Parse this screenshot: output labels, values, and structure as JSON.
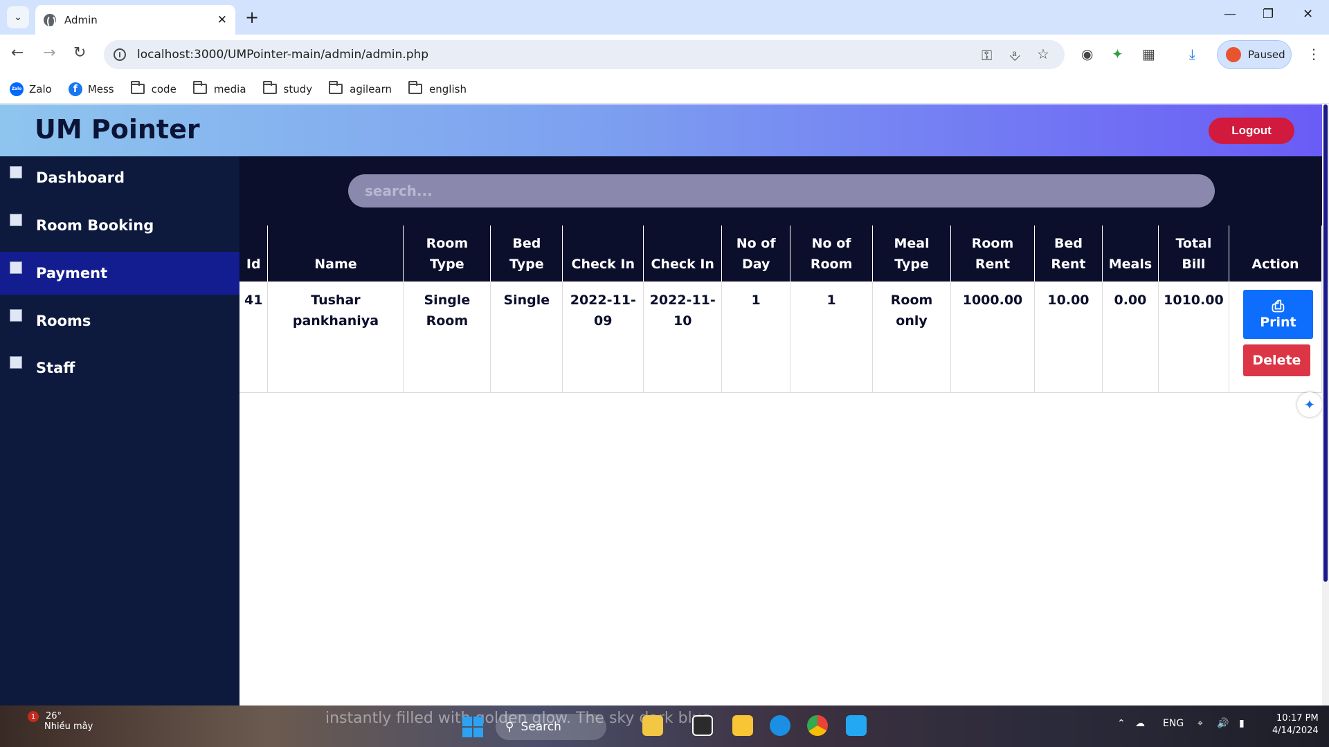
{
  "browser": {
    "tab_title": "Admin",
    "url": "localhost:3000/UMPointer-main/admin/admin.php",
    "profile_label": "Paused",
    "bookmarks": [
      "Zalo",
      "Mess",
      "code",
      "media",
      "study",
      "agilearn",
      "english"
    ]
  },
  "header": {
    "brand": "UM Pointer",
    "logout_label": "Logout"
  },
  "sidebar": {
    "items": [
      {
        "label": "Dashboard"
      },
      {
        "label": "Room Booking"
      },
      {
        "label": "Payment"
      },
      {
        "label": "Rooms"
      },
      {
        "label": "Staff"
      }
    ],
    "active_index": 2
  },
  "search": {
    "placeholder": "search..."
  },
  "table": {
    "headers": [
      "Id",
      "Name",
      "Room Type",
      "Bed Type",
      "Check In",
      "Check In",
      "No of Day",
      "No of Room",
      "Meal Type",
      "Room Rent",
      "Bed Rent",
      "Meals",
      "Total Bill",
      "Action"
    ],
    "rows": [
      {
        "id": "41",
        "name": "Tushar pankhaniya",
        "room_type": "Single Room",
        "bed_type": "Single",
        "check_in": "2022-11-09",
        "check_out": "2022-11-10",
        "no_of_day": "1",
        "no_of_room": "1",
        "meal_type": "Room only",
        "room_rent": "1000.00",
        "bed_rent": "10.00",
        "meals": "0.00",
        "total_bill": "1010.00",
        "print_label": "Print",
        "delete_label": "Delete"
      }
    ]
  },
  "taskbar": {
    "weather_temp": "26°",
    "weather_desc": "Nhiều mây",
    "notification_count": "1",
    "ticker_text": "instantly filled with golden glow. The sky dark blue",
    "search_label": "Search",
    "language": "ENG",
    "time": "10:17 PM",
    "date": "4/14/2024"
  }
}
